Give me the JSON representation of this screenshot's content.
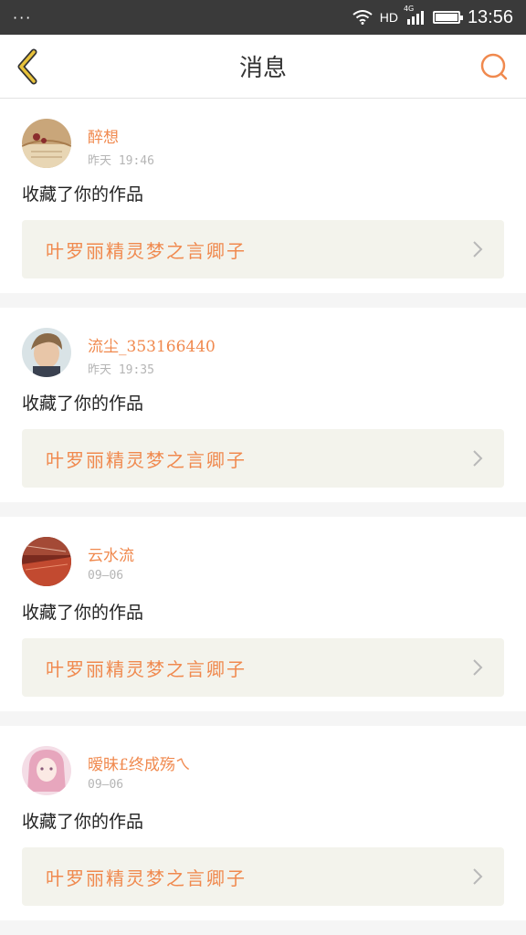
{
  "status_bar": {
    "left": "···",
    "network": "HD",
    "signal_type": "4G",
    "time": "13:56",
    "icons": [
      "wifi-icon",
      "signal-icon",
      "battery-icon"
    ]
  },
  "header": {
    "title": "消息",
    "back_icon": "chevron-left-icon",
    "search_icon": "search-icon"
  },
  "colors": {
    "accent": "#f0894e",
    "back_arrow": "#e8c23a",
    "work_box_bg": "#f3f3ec"
  },
  "messages": [
    {
      "username": "醉想",
      "time": "昨天 19:46",
      "action": "收藏了你的作品",
      "work_title": "叶罗丽精灵梦之言卿子"
    },
    {
      "username": "流尘_353166440",
      "time": "昨天 19:35",
      "action": "收藏了你的作品",
      "work_title": "叶罗丽精灵梦之言卿子"
    },
    {
      "username": "云水流",
      "time": "09—06",
      "action": "收藏了你的作品",
      "work_title": "叶罗丽精灵梦之言卿子"
    },
    {
      "username": "暧昧£终成殇ㄟ",
      "time": "09—06",
      "action": "收藏了你的作品",
      "work_title": "叶罗丽精灵梦之言卿子"
    }
  ]
}
